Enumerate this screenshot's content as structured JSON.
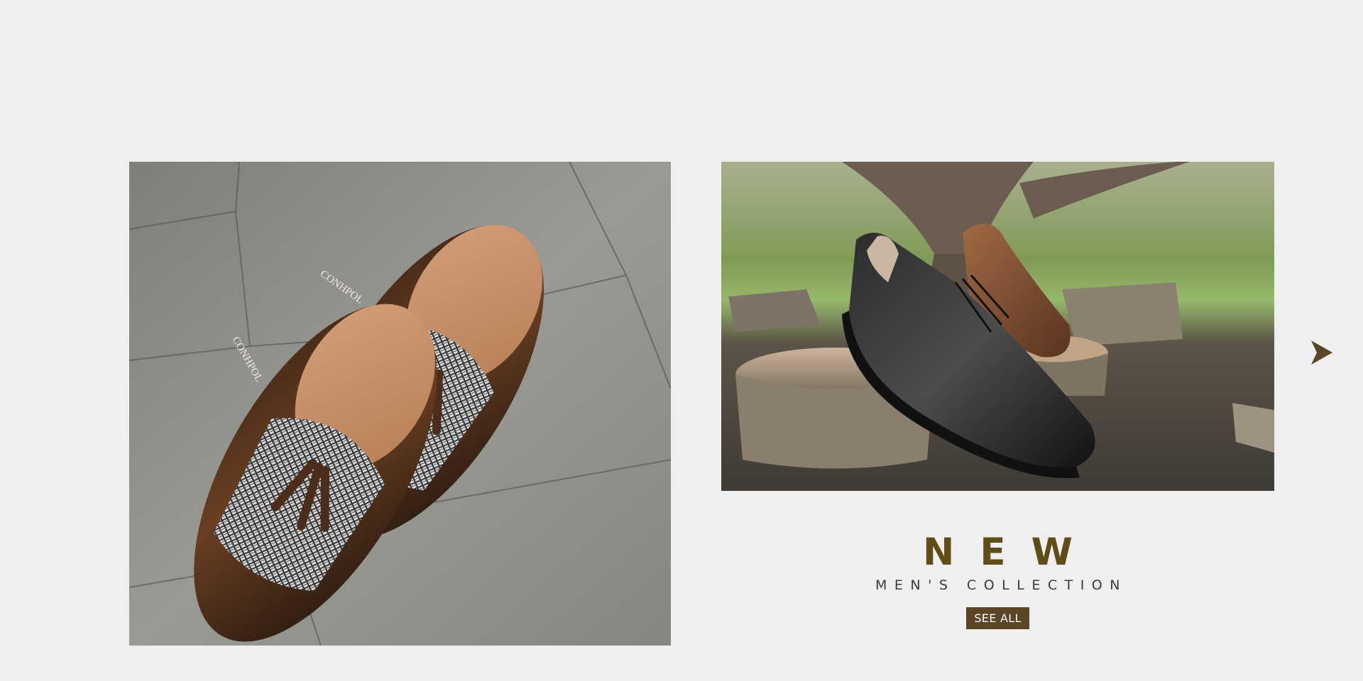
{
  "carousel": {
    "slide": {
      "left_image": {
        "icon": "tassel-loafers-photo",
        "brand_mark": "CONHPOL"
      },
      "right_image": {
        "icon": "leather-sneakers-garden-photo"
      },
      "promo": {
        "title": "NEW",
        "subtitle": "MEN'S COLLECTION",
        "button_label": "SEE ALL"
      }
    },
    "next_icon": "chevron-right-icon"
  },
  "colors": {
    "page_bg": "#efefef",
    "title": "#5e4d16",
    "subtitle": "#3b3b3b",
    "button_bg": "#5a4525",
    "button_text": "#ffffff",
    "arrow": "#5a4525"
  }
}
